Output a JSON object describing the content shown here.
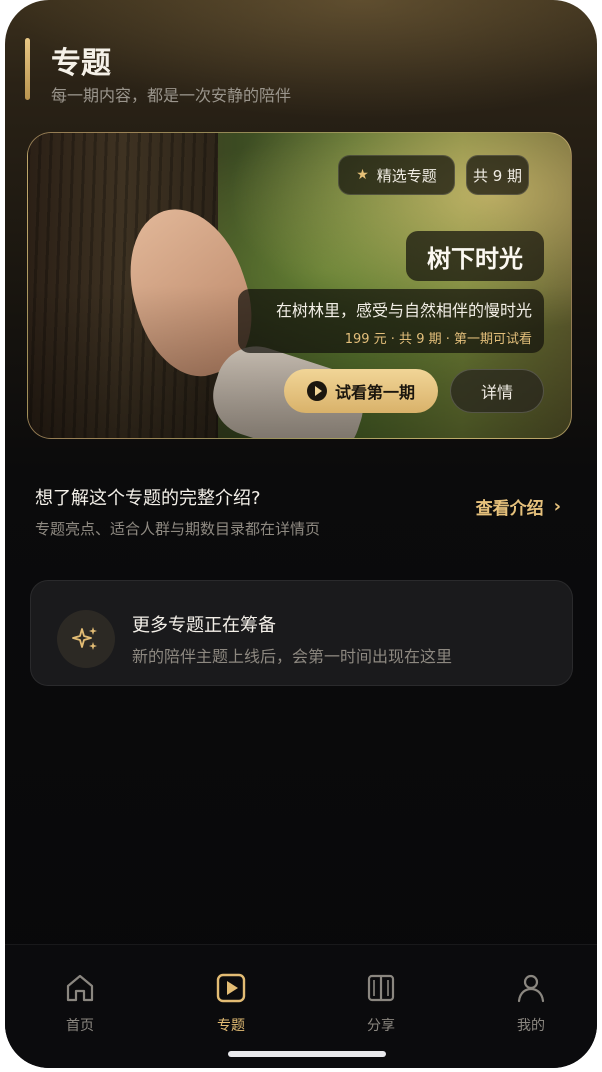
{
  "header": {
    "title": "专题",
    "subtitle": "每一期内容，都是一次安静的陪伴"
  },
  "hero": {
    "featured_chip": "精选专题",
    "count_chip": "共 9 期",
    "title": "树下时光",
    "description": "在树林里，感受与自然相伴的慢时光",
    "meta": "199 元 · 共 9 期 · 第一期可试看",
    "trial_button": "试看第一期",
    "detail_button": "详情"
  },
  "intro": {
    "question": "想了解这个专题的完整介绍?",
    "subtitle": "专题亮点、适合人群与期数目录都在详情页",
    "link": "查看介绍"
  },
  "coming_soon": {
    "icon": "sparkles-icon",
    "title": "更多专题正在筹备",
    "subtitle": "新的陪伴主题上线后，会第一时间出现在这里"
  },
  "tabbar": {
    "items": [
      {
        "label": "首页",
        "icon": "home-icon",
        "active": false
      },
      {
        "label": "专题",
        "icon": "play-square-icon",
        "active": true
      },
      {
        "label": "分享",
        "icon": "book-icon",
        "active": false
      },
      {
        "label": "我的",
        "icon": "user-icon",
        "active": false
      }
    ]
  },
  "colors": {
    "accent": "#e3bc74",
    "background": "#08080a",
    "card": "#1a1a1c"
  }
}
